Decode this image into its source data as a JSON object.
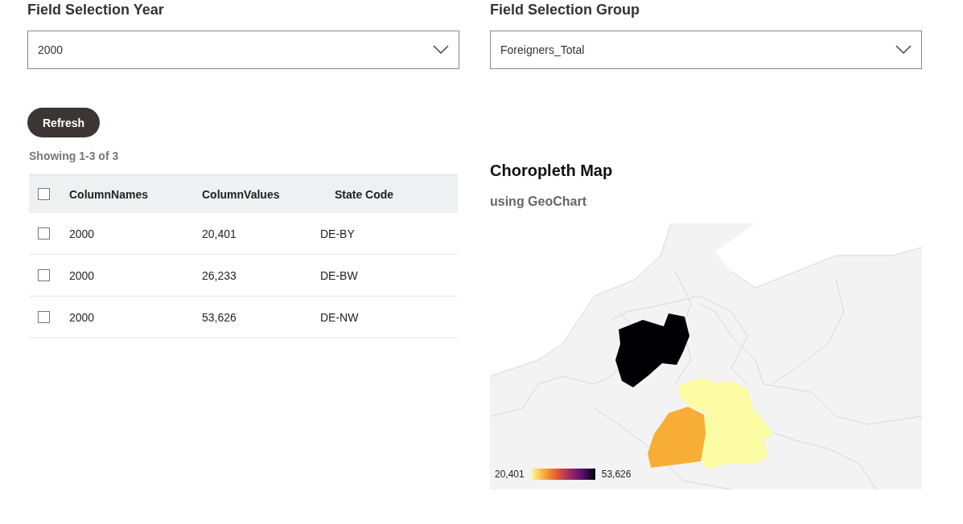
{
  "filters": [
    {
      "label": "Field Selection Year",
      "value": "2000"
    },
    {
      "label": "Field Selection Group",
      "value": "Foreigners_Total"
    }
  ],
  "refresh_button": "Refresh",
  "showing": "Showing 1-3 of 3",
  "table": {
    "select_all_checked": false,
    "columns": [
      "ColumnNames",
      "ColumnValues",
      "State Code"
    ],
    "rows": [
      {
        "checked": false,
        "cells": [
          "2000",
          "20,401",
          "DE-BY"
        ]
      },
      {
        "checked": false,
        "cells": [
          "2000",
          "26,233",
          "DE-BW"
        ]
      },
      {
        "checked": false,
        "cells": [
          "2000",
          "53,626",
          "DE-NW"
        ]
      }
    ]
  },
  "map": {
    "title": "Choropleth Map",
    "subtitle": "using GeoChart",
    "regions": [
      {
        "kind": "bavaria",
        "color": "#fbfca3"
      },
      {
        "kind": "baden-wuerttemberg",
        "color": "#f8ad37"
      },
      {
        "kind": "north-rhine-westphalia",
        "color": "#000004"
      }
    ],
    "legend": {
      "min": "20,401",
      "max": "53,626"
    }
  }
}
